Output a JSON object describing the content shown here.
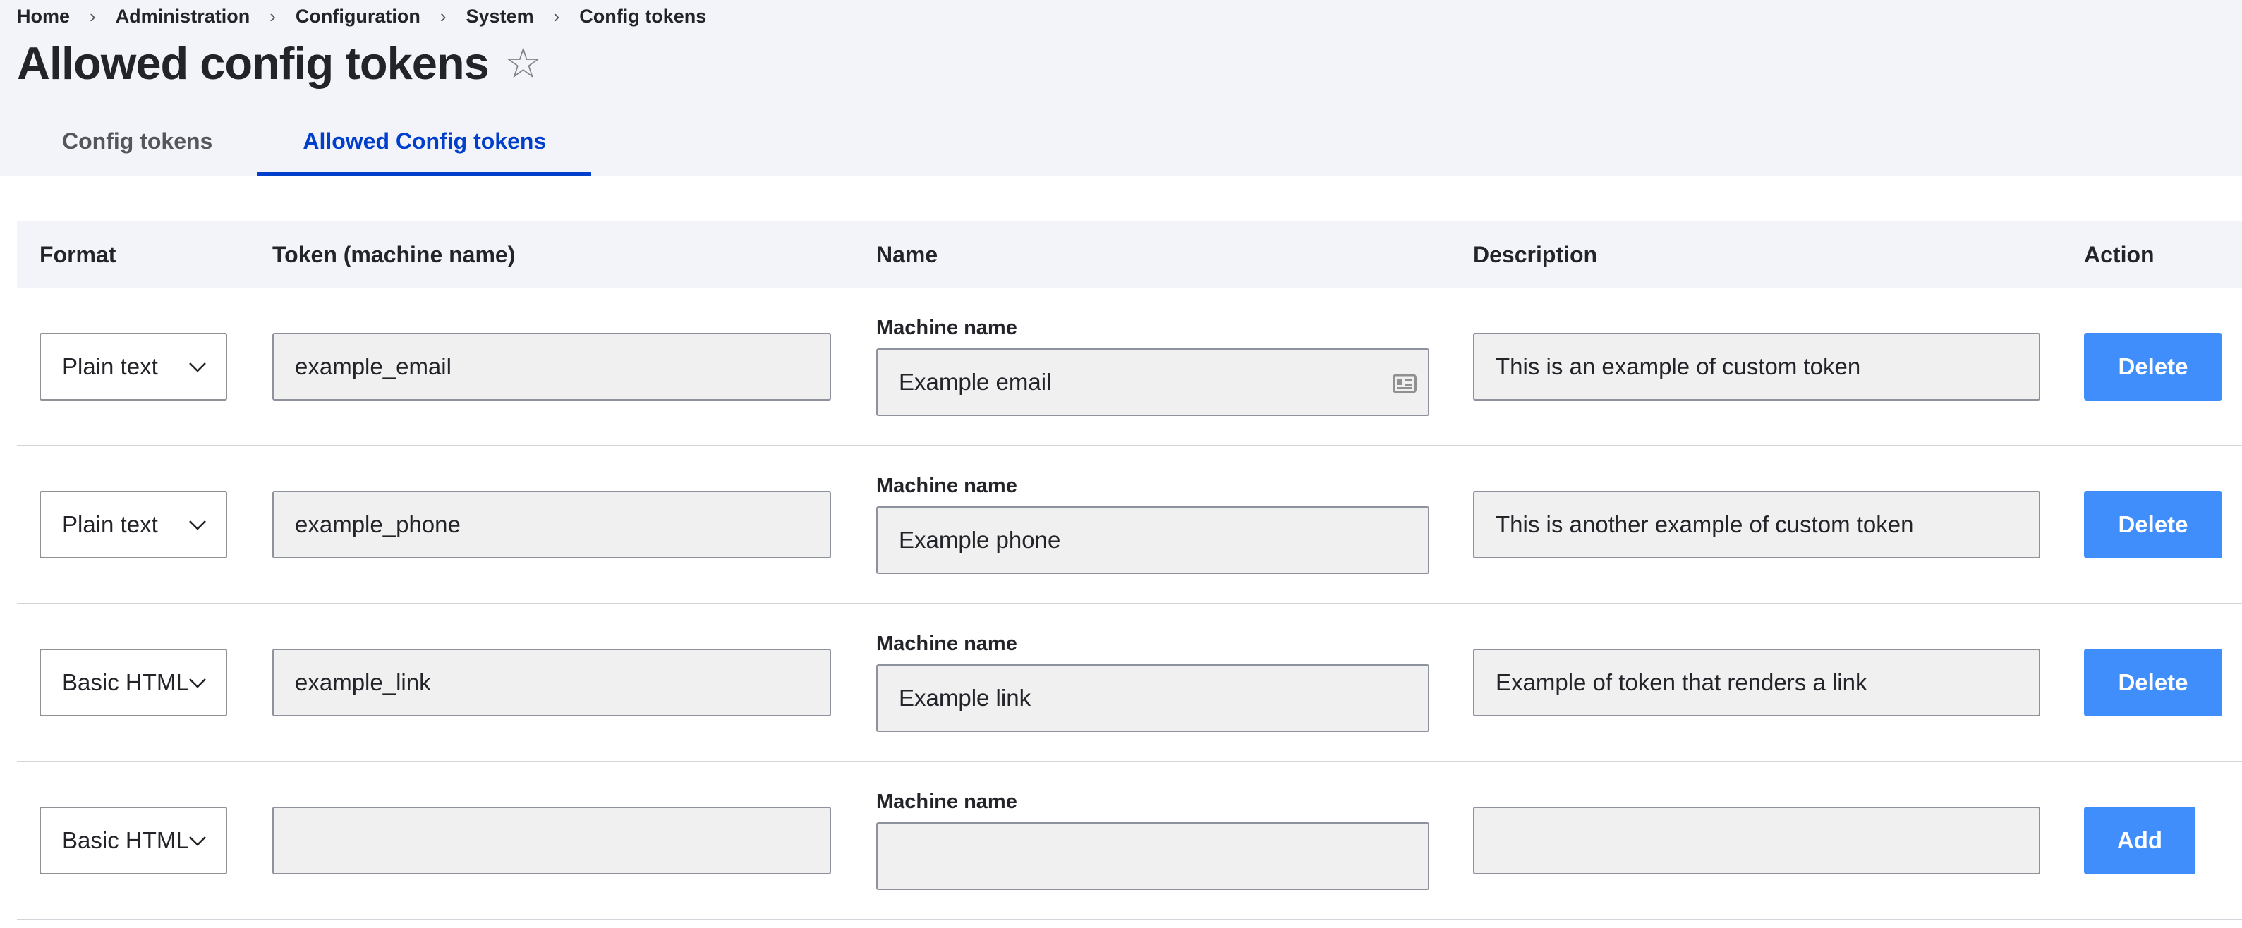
{
  "breadcrumb": [
    "Home",
    "Administration",
    "Configuration",
    "System",
    "Config tokens"
  ],
  "breadcrumb_separator": "›",
  "page_title": "Allowed config tokens",
  "tabs": [
    {
      "label": "Config tokens",
      "active": false
    },
    {
      "label": "Allowed Config tokens",
      "active": true
    }
  ],
  "table": {
    "headers": {
      "format": "Format",
      "token": "Token (machine name)",
      "name": "Name",
      "description": "Description",
      "action": "Action"
    },
    "machine_name_label": "Machine name",
    "rows": [
      {
        "format": "Plain text",
        "token": "example_email",
        "name": "Example email",
        "description": "This is an example of custom token",
        "action": "Delete"
      },
      {
        "format": "Plain text",
        "token": "example_phone",
        "name": "Example phone",
        "description": "This is another example of custom token",
        "action": "Delete"
      },
      {
        "format": "Basic HTML",
        "token": "example_link",
        "name": "Example link",
        "description": "Example of token that renders a link",
        "action": "Delete"
      },
      {
        "format": "Basic HTML",
        "token": "",
        "name": "",
        "description": "",
        "action": "Add"
      }
    ]
  },
  "colors": {
    "header_bg": "#f3f4f9",
    "active_tab": "#003ecc",
    "button_bg": "#3f8efc",
    "input_bg": "#f0f0f0"
  }
}
